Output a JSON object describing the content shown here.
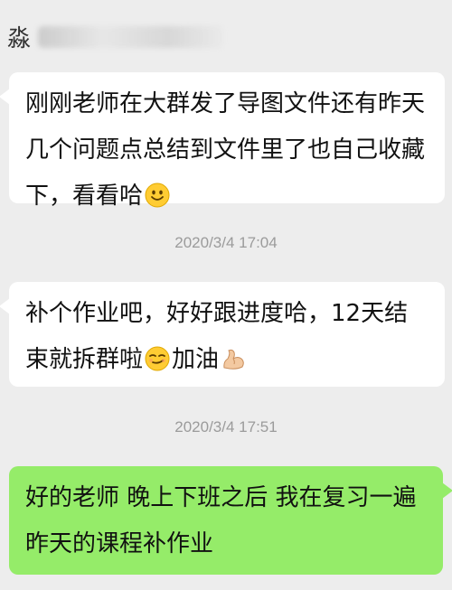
{
  "header": {
    "contact_name": "淼"
  },
  "messages": [
    {
      "direction": "incoming",
      "text": "刚刚老师在大群发了导图文件还有昨天几个问题点总结到文件里了也自己收藏下，看看哈",
      "emoji": "smile-emoji"
    },
    {
      "direction": "incoming",
      "text_before_emoji": "补个作业吧，好好跟进度哈，12天结束就拆群啦",
      "emoji1": "smirk-emoji",
      "text_after_emoji": "加油",
      "emoji2": "flexed-biceps-emoji"
    },
    {
      "direction": "outgoing",
      "text": "好的老师 晚上下班之后 我在复习一遍昨天的课程补作业"
    }
  ],
  "timestamps": [
    "2020/3/4 17:04",
    "2020/3/4 17:51"
  ],
  "colors": {
    "background": "#ededed",
    "incoming_bubble": "#ffffff",
    "outgoing_bubble": "#95ec69",
    "timestamp_text": "#9b9b9b"
  }
}
